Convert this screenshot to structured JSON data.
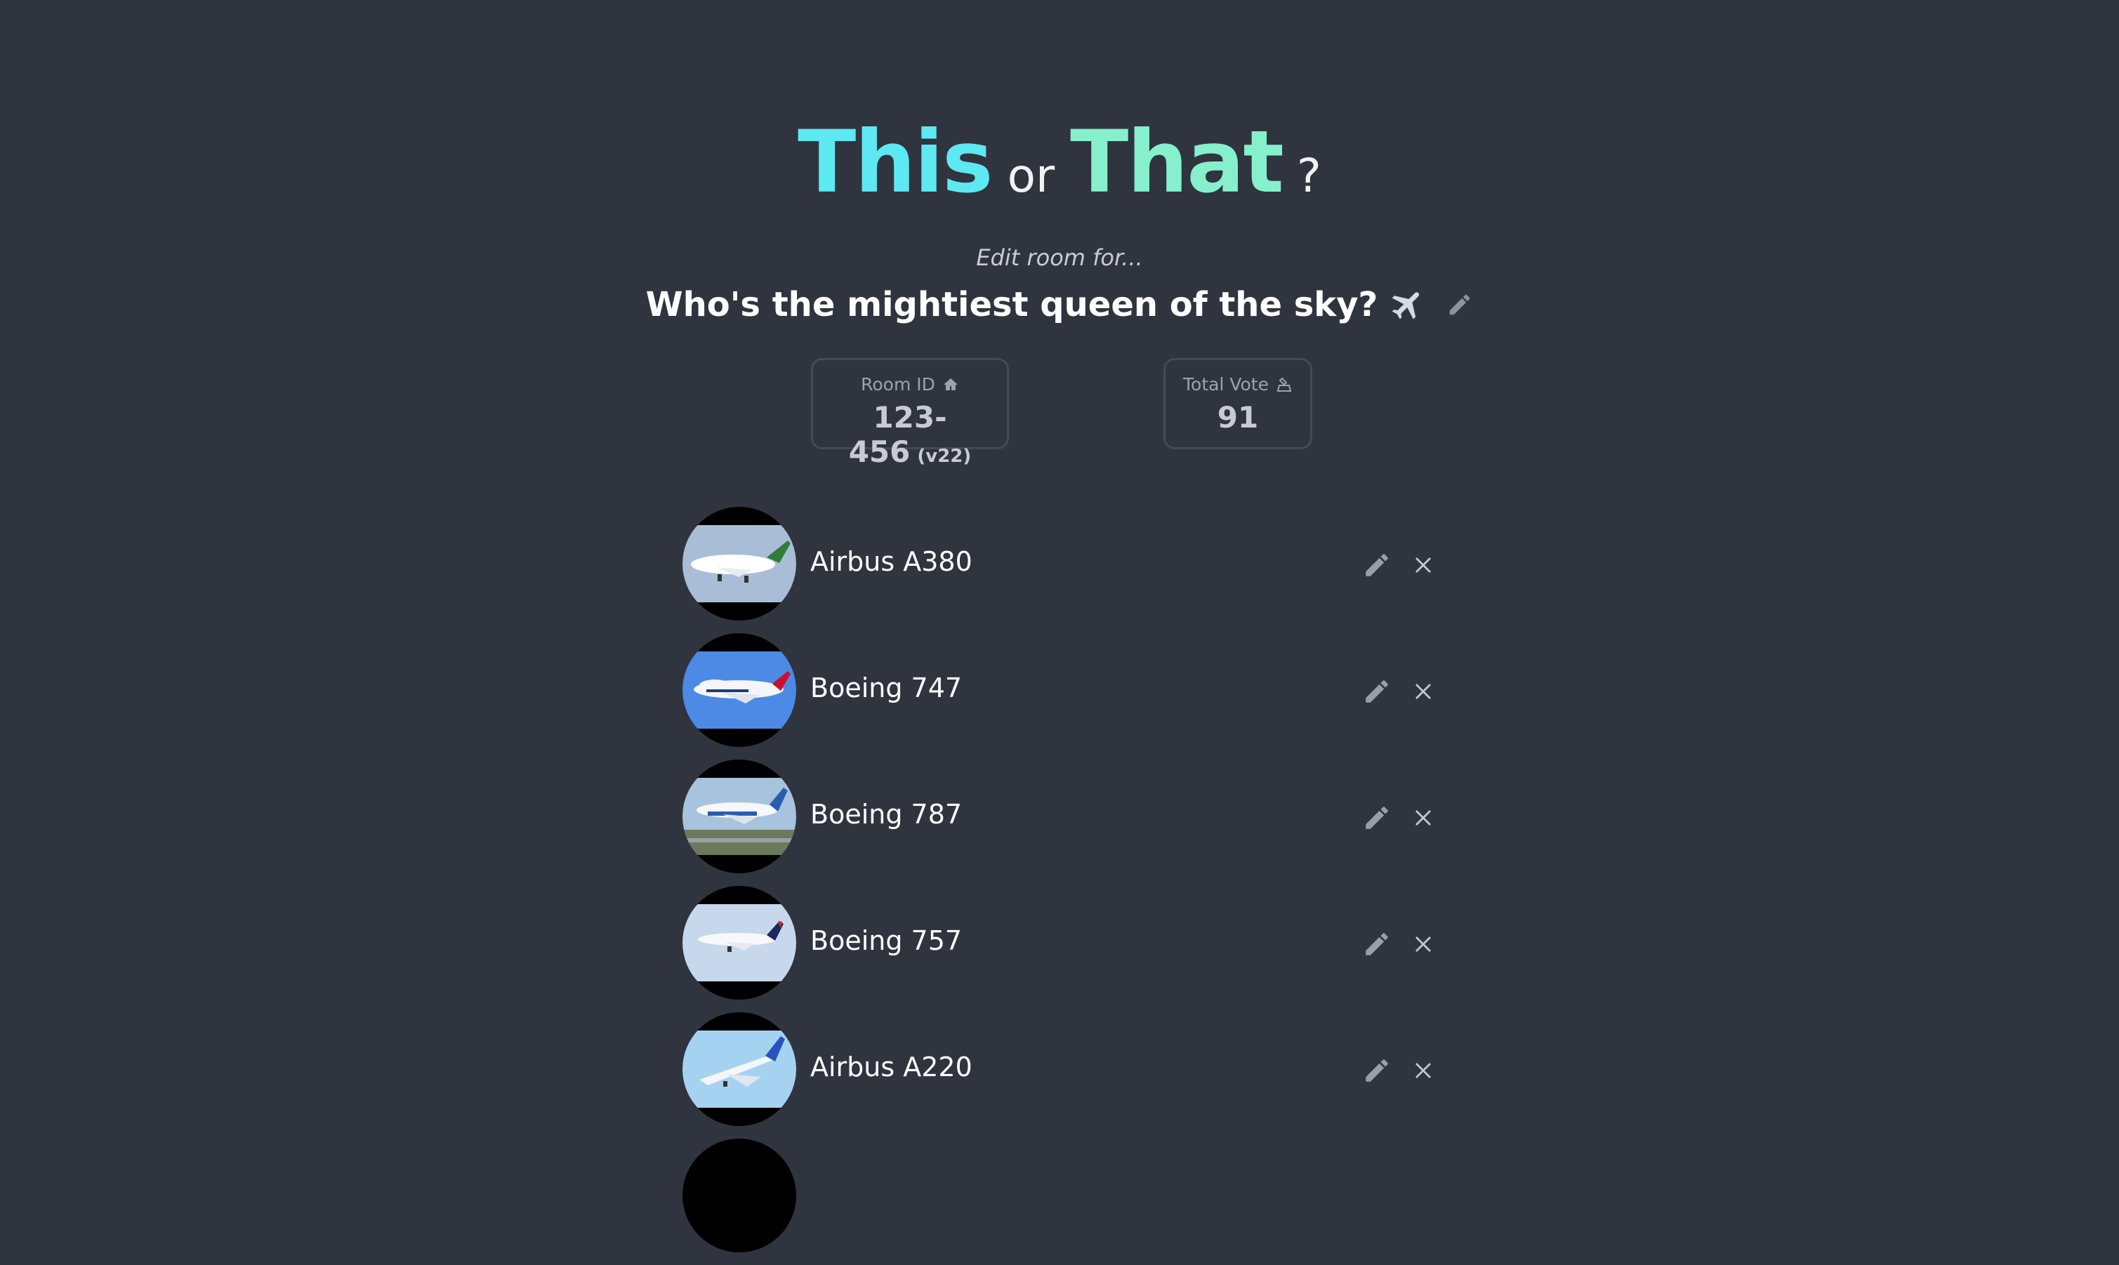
{
  "header": {
    "this_word": "This",
    "or_word": "or",
    "that_word": "That",
    "question_mark": "?"
  },
  "room": {
    "subtitle": "Edit room for...",
    "question": "Who's the mightiest queen of the sky?"
  },
  "stats": {
    "room_id_label": "Room ID",
    "room_id": "123-456",
    "version": "(v22)",
    "total_vote_label": "Total Vote",
    "total_vote": "91"
  },
  "options": [
    {
      "name": "Airbus A380",
      "sky": "#a9bdd6",
      "icon": "plane-photo-a380"
    },
    {
      "name": "Boeing 747",
      "sky": "#4d8ae6",
      "icon": "plane-photo-747"
    },
    {
      "name": "Boeing 787",
      "sky": "#a8c3de",
      "icon": "plane-photo-787"
    },
    {
      "name": "Boeing 757",
      "sky": "#c7d8ec",
      "icon": "plane-photo-757"
    },
    {
      "name": "Airbus A220",
      "sky": "#a6d2f2",
      "icon": "plane-photo-a220"
    }
  ],
  "icons": {
    "title_emoji": "airplane-icon",
    "edit": "pencil-icon",
    "delete": "close-icon",
    "room": "house-icon",
    "vote": "ballot-icon"
  },
  "colors": {
    "background": "#30343f",
    "this_accent": "#5ee8f2",
    "that_accent": "#86f0cc"
  }
}
